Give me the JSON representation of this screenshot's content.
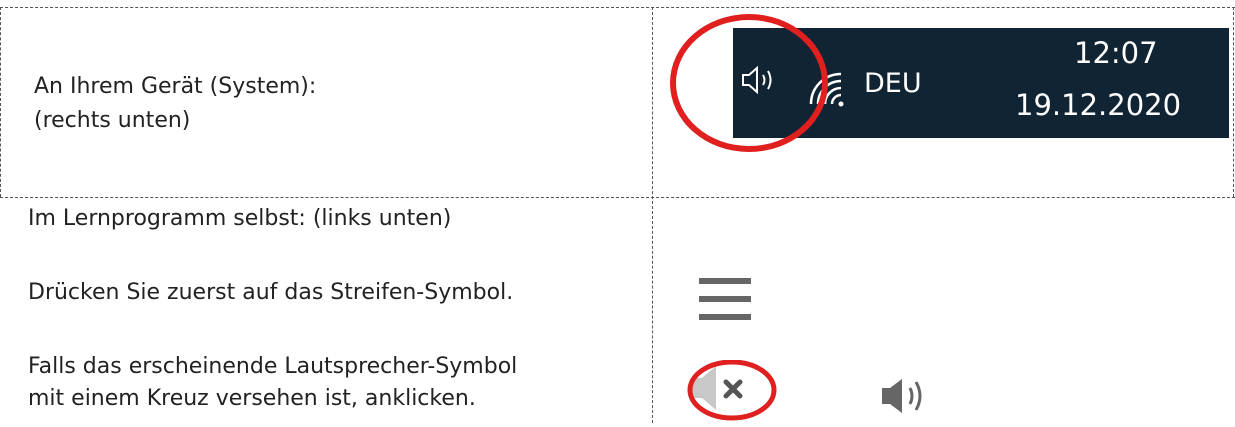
{
  "rows": [
    {
      "lines": [
        "An Ihrem Gerät (System):",
        "(rechts unten)"
      ],
      "taskbar": {
        "language": "DEU",
        "time": "12:07",
        "date": "19.12.2020",
        "icons": [
          "speaker-icon",
          "wifi-icon"
        ]
      },
      "highlight_color": "#e01f1f"
    },
    {
      "heading": "Im Lernprogramm selbst: (links unten)",
      "step1": "Drücken Sie zuerst auf das Streifen-Symbol.",
      "step2_lines": [
        "Falls das erscheinende Lautsprecher-Symbol",
        "mit einem Kreuz versehen ist, anklicken."
      ],
      "icons": [
        "hamburger-menu-icon",
        "speaker-muted-icon",
        "speaker-on-icon"
      ]
    }
  ]
}
